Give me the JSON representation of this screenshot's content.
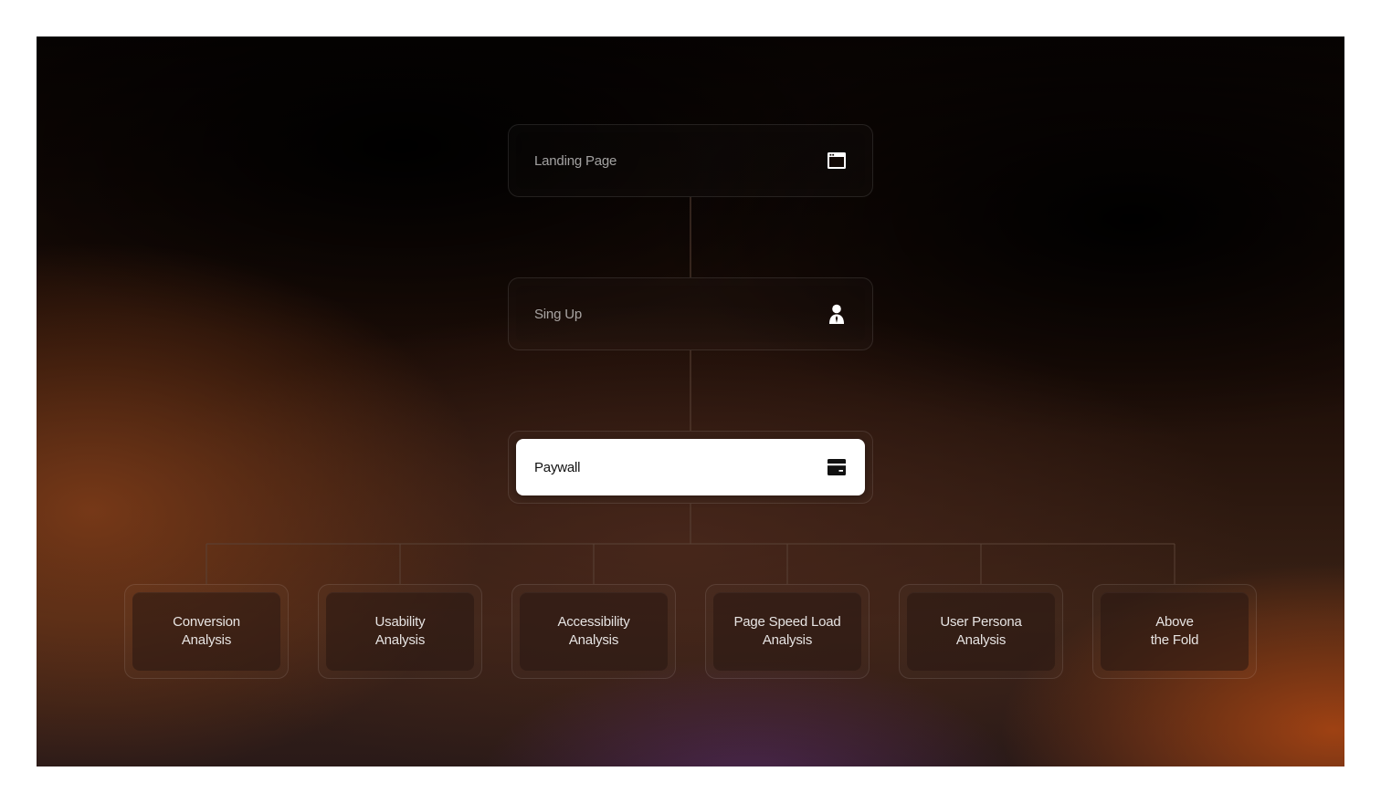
{
  "flow": {
    "nodes": [
      {
        "label": "Landing Page",
        "icon": "browser-window-icon",
        "state": "default"
      },
      {
        "label": "Sing Up",
        "icon": "user-icon",
        "state": "default"
      },
      {
        "label": "Paywall",
        "icon": "credit-card-icon",
        "state": "active"
      }
    ],
    "branches": [
      {
        "label": "Conversion\nAnalysis"
      },
      {
        "label": "Usability\nAnalysis"
      },
      {
        "label": "Accessibility\nAnalysis"
      },
      {
        "label": "Page Speed Load\nAnalysis"
      },
      {
        "label": "User Persona\nAnalysis"
      },
      {
        "label": "Above\nthe Fold"
      }
    ]
  },
  "colors": {
    "active_background": "#ffffff",
    "active_text": "#111111",
    "connector": "#5a4236"
  }
}
